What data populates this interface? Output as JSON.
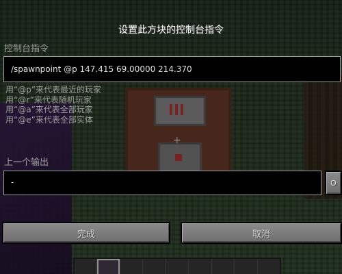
{
  "window": {
    "title": "设置此方块的控制台指令"
  },
  "command": {
    "label": "控制台指令",
    "value": "/spawnpoint @p 147.415 69.00000 214.370"
  },
  "hints": [
    "用“@p”来代表最近的玩家",
    "用“@r”来代表随机玩家",
    "用“@a”来代表全部玩家",
    "用“@e”来代表全部实体"
  ],
  "previous_output": {
    "label": "上一个输出",
    "value": "-",
    "toggle_label": "O"
  },
  "buttons": {
    "done_label": "完成",
    "cancel_label": "取消"
  },
  "colors": {
    "label_gray": "#a0a0a0",
    "field_bg": "#000000",
    "button_face": "#7f7f7f"
  }
}
